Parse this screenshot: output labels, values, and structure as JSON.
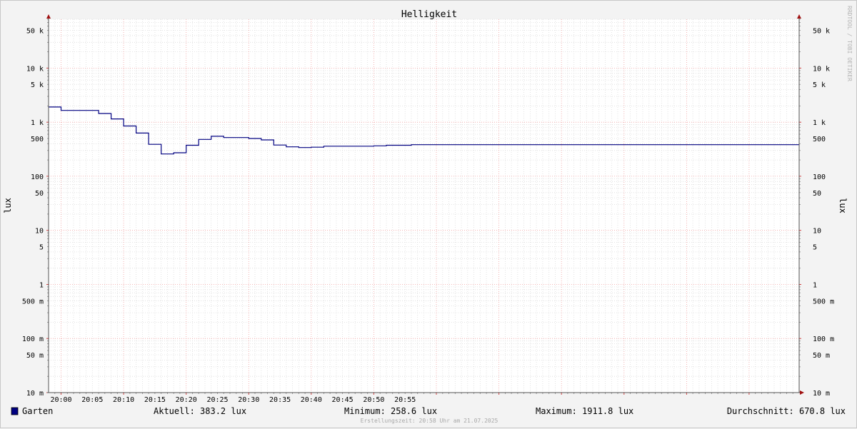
{
  "chart_data": {
    "type": "line",
    "title": "Helligkeit",
    "ylabel": "lux",
    "y_scale": "log",
    "ylim": [
      0.01,
      80000
    ],
    "xlim": [
      "19:58",
      "21:58"
    ],
    "y_ticks": [
      {
        "value": 50000,
        "label": "50 k"
      },
      {
        "value": 10000,
        "label": "10 k"
      },
      {
        "value": 5000,
        "label": "5 k"
      },
      {
        "value": 1000,
        "label": "1 k"
      },
      {
        "value": 500,
        "label": "500"
      },
      {
        "value": 100,
        "label": "100"
      },
      {
        "value": 50,
        "label": "50"
      },
      {
        "value": 10,
        "label": "10"
      },
      {
        "value": 5,
        "label": "5"
      },
      {
        "value": 1,
        "label": "1"
      },
      {
        "value": 0.5,
        "label": "500 m"
      },
      {
        "value": 0.1,
        "label": "100 m"
      },
      {
        "value": 0.05,
        "label": "50 m"
      },
      {
        "value": 0.01,
        "label": "10 m"
      }
    ],
    "x_ticks": [
      "20:00",
      "20:05",
      "20:10",
      "20:15",
      "20:20",
      "20:25",
      "20:30",
      "20:35",
      "20:40",
      "20:45",
      "20:50",
      "20:55"
    ],
    "grid": true,
    "legend": "bottom-left",
    "series": [
      {
        "name": "Garten",
        "color": "#000080",
        "step": true,
        "x": [
          "19:58",
          "20:00",
          "20:06",
          "20:08",
          "20:10",
          "20:12",
          "20:14",
          "20:16",
          "20:18",
          "20:20",
          "20:22",
          "20:24",
          "20:26",
          "20:30",
          "20:32",
          "20:34",
          "20:36",
          "20:38",
          "20:40",
          "20:42",
          "20:50",
          "20:52",
          "20:56"
        ],
        "y": [
          1911.8,
          1650,
          1450,
          1150,
          850,
          630,
          390,
          258.6,
          272,
          375,
          480,
          550,
          520,
          500,
          470,
          378,
          350,
          340,
          345,
          360,
          365,
          375,
          383.2
        ]
      }
    ]
  },
  "legend": {
    "series_name": "Garten",
    "series_color": "#000080",
    "current": "Aktuell: 383.2 lux",
    "minimum": "Minimum: 258.6 lux",
    "maximum": "Maximum: 1911.8 lux",
    "average": "Durchschnitt: 670.8 lux"
  },
  "footer": "Erstellungszeit: 20:58 Uhr am 21.07.2025",
  "watermark": "RRDTOOL / TOBI OETIKER"
}
